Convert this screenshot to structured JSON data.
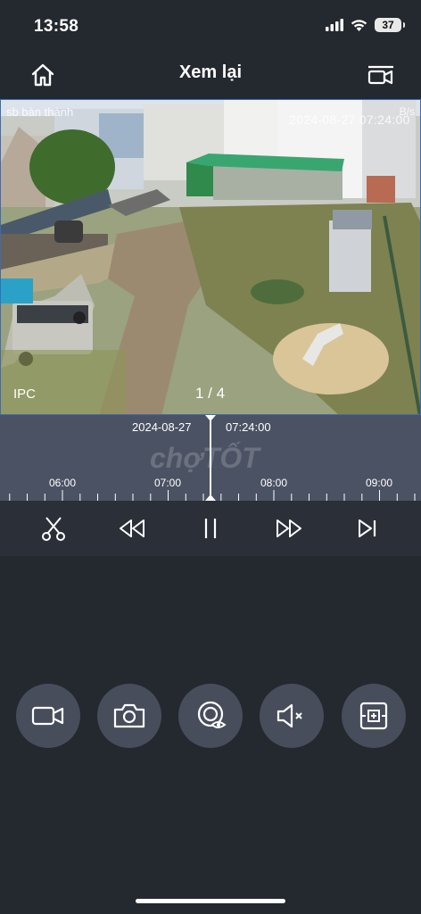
{
  "status_bar": {
    "time": "13:58",
    "battery": "37"
  },
  "header": {
    "title": "Xem lại"
  },
  "video": {
    "camera_name": "sb bàn thành",
    "osd_datetime": "2024-08-27 07:24:00",
    "osd_rate": "B/s",
    "label": "IPC",
    "page_indicator": "1 / 4"
  },
  "timeline": {
    "date": "2024-08-27",
    "cursor_time": "07:24:00",
    "watermark": "chợTỐT",
    "hour_labels": [
      "06:00",
      "07:00",
      "08:00",
      "09:00"
    ]
  },
  "playback_controls": [
    "scissors-icon",
    "rewind-icon",
    "pause-icon",
    "fast-forward-icon",
    "skip-next-icon"
  ],
  "action_buttons": [
    "video-record-icon",
    "camera-icon",
    "eye-record-icon",
    "mute-icon",
    "digital-zoom-icon"
  ],
  "colors": {
    "background": "#24282f",
    "timeline": "#4b5263",
    "action_button": "#474d5b",
    "video_border": "#3c6cb5"
  }
}
